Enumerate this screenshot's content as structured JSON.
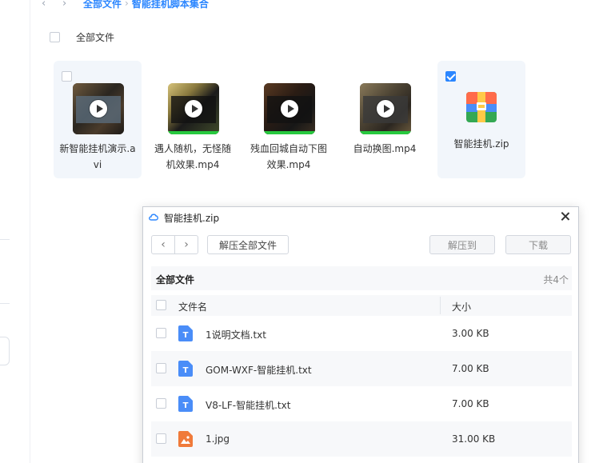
{
  "breadcrumb": {
    "back_icon": "chevron-left-icon",
    "forward_icon": "chevron-right-icon",
    "root": "全部文件",
    "separator": "›",
    "current": "智能挂机脚本集合"
  },
  "select_all_label": "全部文件",
  "files": [
    {
      "name": "新智能挂机演示.avi",
      "type": "video",
      "checked": false,
      "highlighted": true
    },
    {
      "name": "遇人随机，无怪随机效果.mp4",
      "type": "video",
      "checked": false,
      "highlighted": false
    },
    {
      "name": "残血回城自动下图效果.mp4",
      "type": "video",
      "checked": false,
      "highlighted": false
    },
    {
      "name": "自动换图.mp4",
      "type": "video",
      "checked": false,
      "highlighted": false
    },
    {
      "name": "智能挂机.zip",
      "type": "zip",
      "checked": true,
      "highlighted": true
    }
  ],
  "dialog": {
    "title": "智能挂机.zip",
    "extract_all": "解压全部文件",
    "extract_to": "解压到",
    "download": "下载",
    "section_title": "全部文件",
    "count": "共4个",
    "col_name": "文件名",
    "col_size": "大小",
    "rows": [
      {
        "name": "1说明文档.txt",
        "size": "3.00 KB",
        "icon": "txt-file-icon"
      },
      {
        "name": "GOM-WXF-智能挂机.txt",
        "size": "7.00 KB",
        "icon": "txt-file-icon"
      },
      {
        "name": "V8-LF-智能挂机.txt",
        "size": "7.00 KB",
        "icon": "txt-file-icon"
      },
      {
        "name": "1.jpg",
        "size": "31.00 KB",
        "icon": "image-file-icon"
      }
    ]
  },
  "colors": {
    "accent": "#2b86ff",
    "txt_icon": "#4a8df8",
    "img_icon": "#f07a3a"
  }
}
